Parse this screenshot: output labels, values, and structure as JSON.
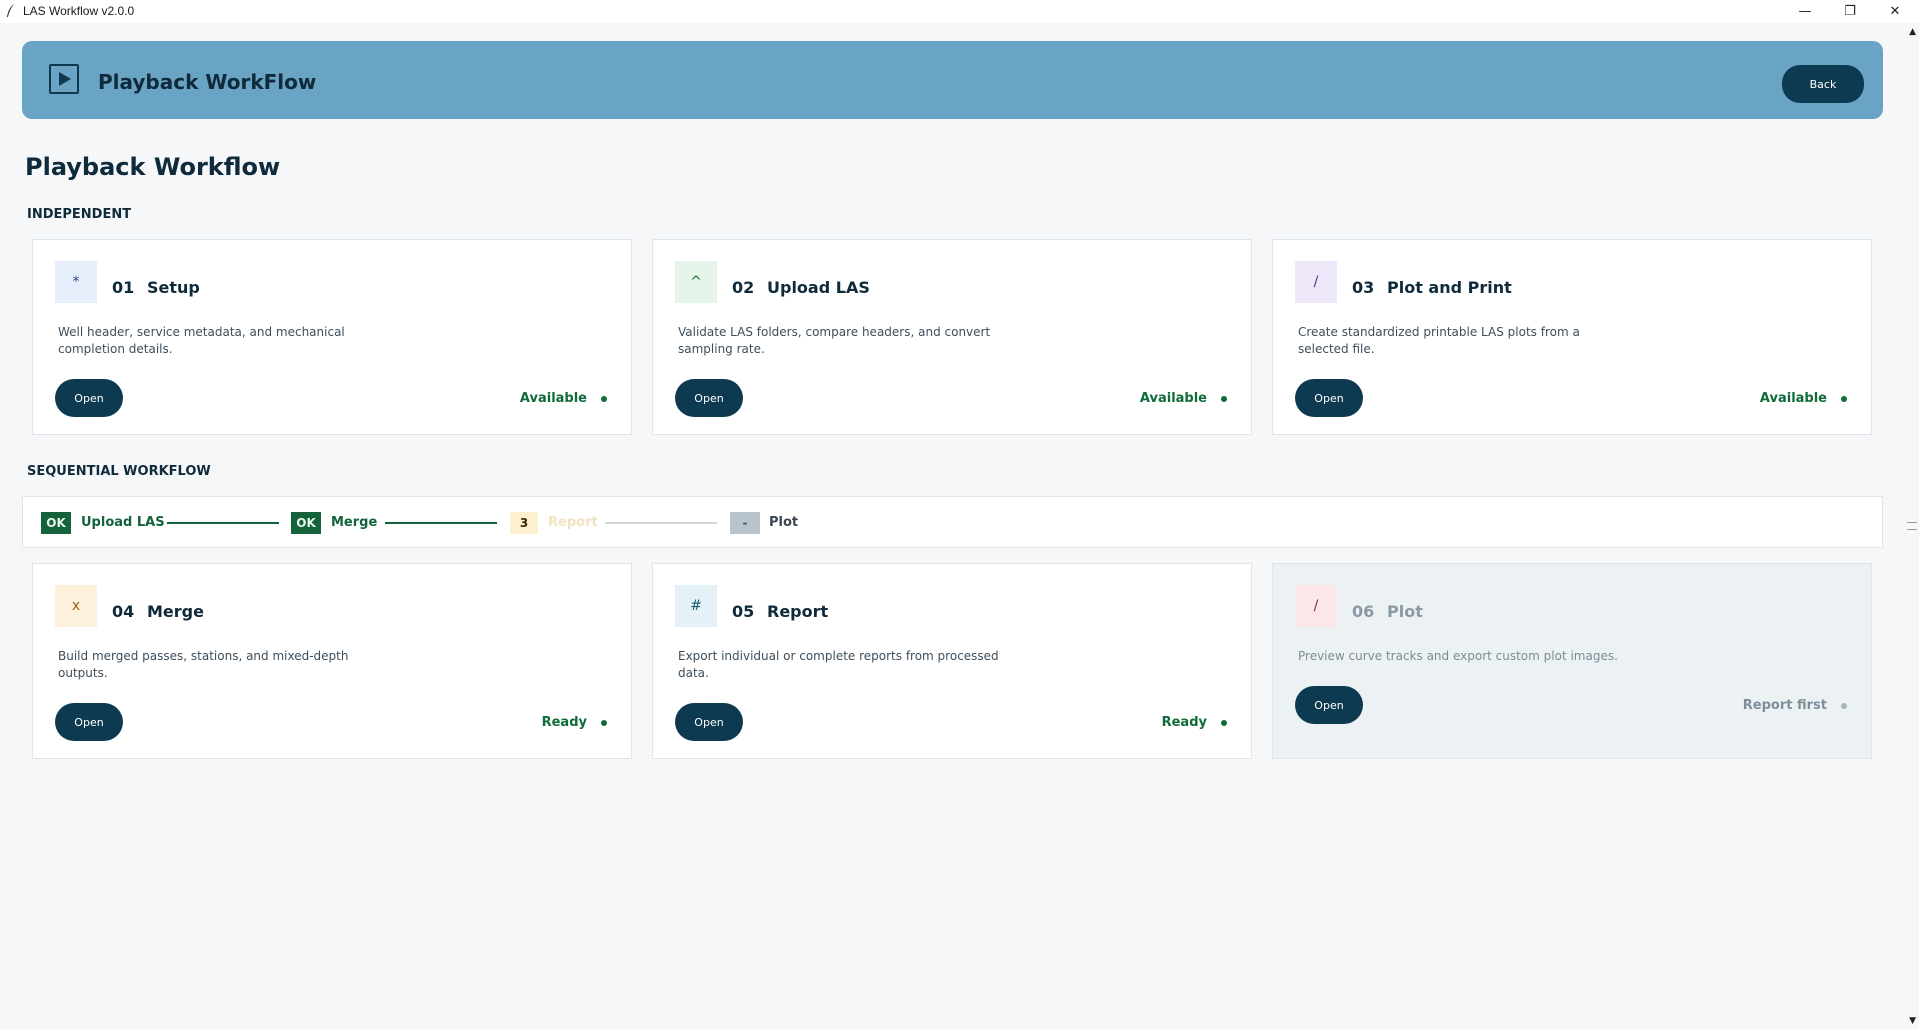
{
  "window": {
    "title": "LAS Workflow v2.0.0",
    "minimize": "—",
    "maximize": "❐",
    "close": "✕"
  },
  "header": {
    "title": "Playback WorkFlow",
    "back_label": "Back"
  },
  "page": {
    "title": "Playback Workflow"
  },
  "independent": {
    "label": "INDEPENDENT",
    "cards": [
      {
        "icon": "*",
        "num": "01",
        "name": "Setup",
        "desc": "Well header, service metadata, and mechanical completion details.",
        "open": "Open",
        "status": "Available",
        "icon_bg": "#e6eefb",
        "icon_color": "#2a4a7a",
        "status_color": "#0f6b3a"
      },
      {
        "icon": "^",
        "num": "02",
        "name": "Upload LAS",
        "desc": "Validate LAS folders, compare headers, and convert sampling rate.",
        "open": "Open",
        "status": "Available",
        "icon_bg": "#e6f5ea",
        "icon_color": "#2a6a3a",
        "status_color": "#0f6b3a"
      },
      {
        "icon": "/",
        "num": "03",
        "name": "Plot and Print",
        "desc": "Create standardized printable LAS plots from a selected file.",
        "open": "Open",
        "status": "Available",
        "icon_bg": "#efe8fb",
        "icon_color": "#4a3a7a",
        "status_color": "#0f6b3a"
      }
    ]
  },
  "sequential": {
    "label": "SEQUENTIAL WORKFLOW",
    "steps": [
      {
        "badge": "OK",
        "label": "Upload LAS"
      },
      {
        "badge": "OK",
        "label": "Merge"
      },
      {
        "badge": "3",
        "label": "Report"
      },
      {
        "badge": "-",
        "label": "Plot"
      }
    ],
    "cards": [
      {
        "icon": "x",
        "num": "04",
        "name": "Merge",
        "desc": "Build merged passes, stations, and mixed-depth outputs.",
        "open": "Open",
        "status": "Ready",
        "icon_bg": "#fdf1dc",
        "icon_color": "#a0601a",
        "status_color": "#0f6b3a"
      },
      {
        "icon": "#",
        "num": "05",
        "name": "Report",
        "desc": "Export individual or complete reports from processed data.",
        "open": "Open",
        "status": "Ready",
        "icon_bg": "#e4f2f7",
        "icon_color": "#1a5a7a",
        "status_color": "#0f6b3a"
      },
      {
        "icon": "/",
        "num": "06",
        "name": "Plot",
        "desc": "Preview curve tracks and export custom plot images.",
        "open": "Open",
        "status": "Report first",
        "icon_bg": "#fbe6ea",
        "icon_color": "#8a2a3a",
        "status_color": "#7f8e99"
      }
    ]
  },
  "colors": {
    "banner": "#6aa4c4",
    "button": "#0d3a50",
    "ok_green": "#14633a",
    "line_green": "#14633a",
    "pending_badge": "#fdf1d2",
    "pending_text": "#f4e6c4",
    "disabled_badge": "#b8c3cb"
  }
}
